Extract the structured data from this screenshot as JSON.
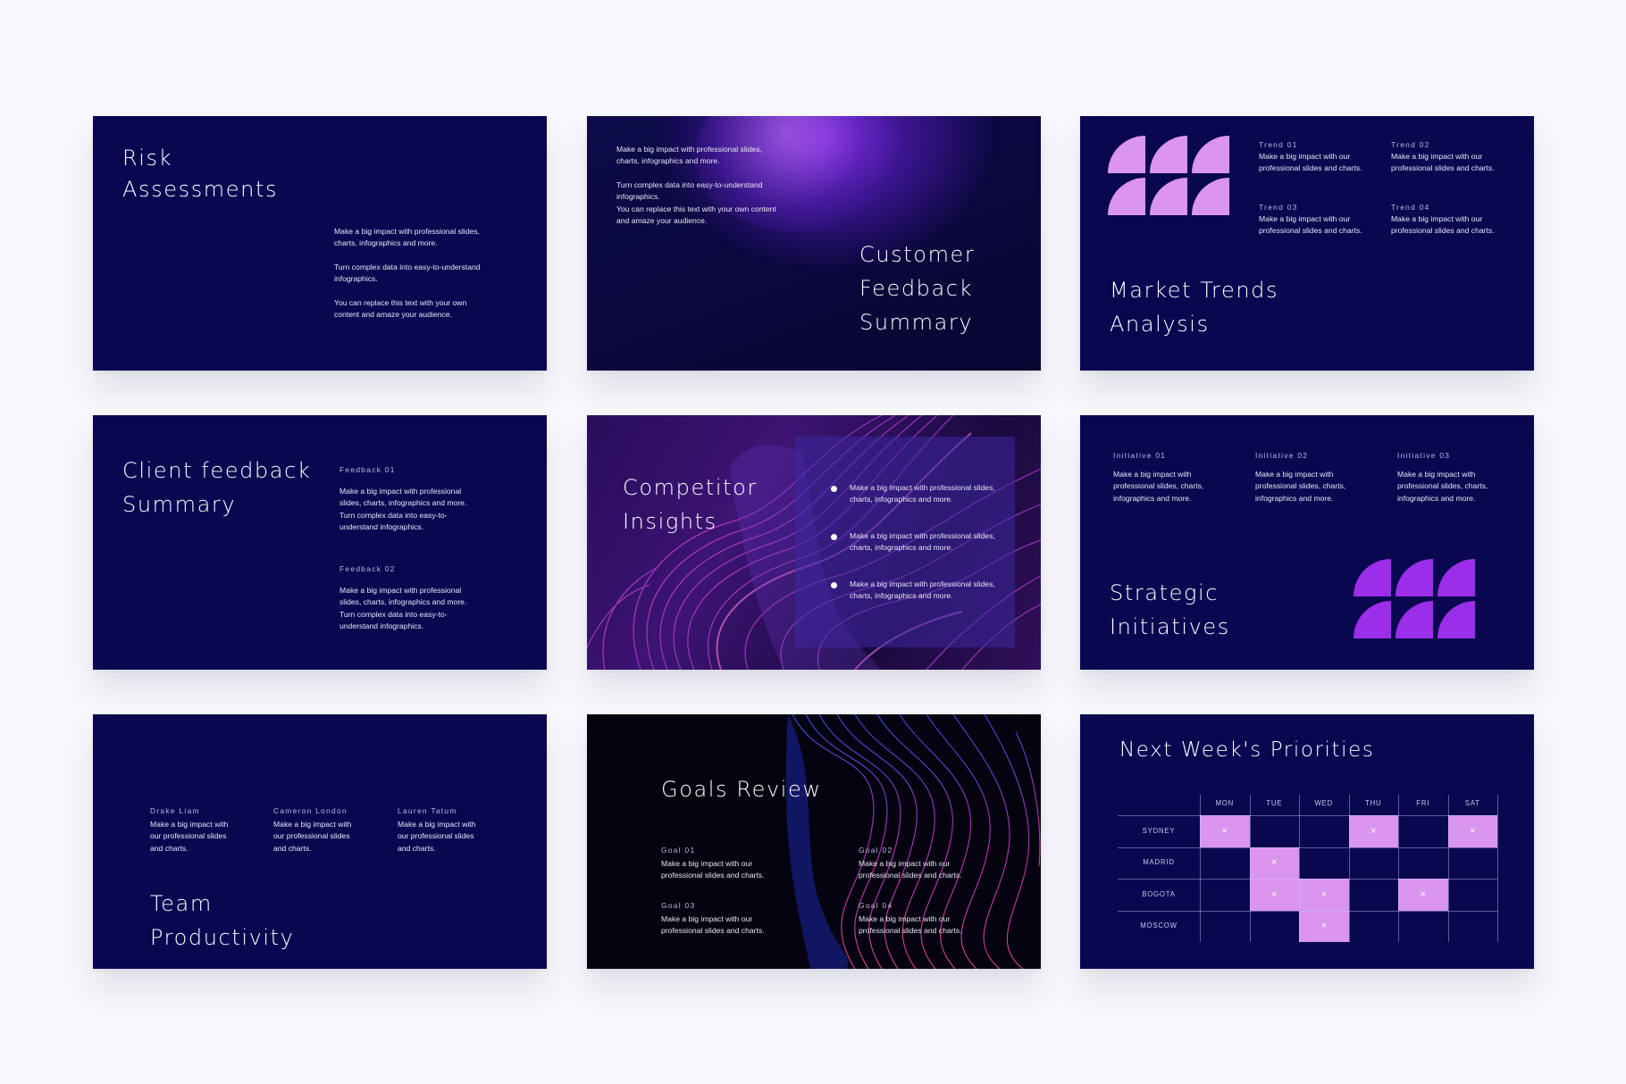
{
  "colors": {
    "page_bg": "#f8f8fc",
    "slide_bg": "#0a0751",
    "accent_pink": "#da95ee",
    "accent_violet": "#9b2ee8",
    "text": "#ffffff"
  },
  "slides": {
    "risk": {
      "title_line1": "Risk",
      "title_line2": "Assessments",
      "body": "Make a big impact with professional slides,\ncharts, infographics and more.\n\nTurn complex data into easy-to-understand\ninfographics.\n\nYou can replace this text with your own\ncontent and amaze your audience."
    },
    "customer": {
      "body": "Make a big impact with professional slides,\ncharts, infographics and more.\n\nTurn complex data into easy-to-understand\ninfographics.\nYou can replace this text with your own content\nand amaze your audience.",
      "title_line1": "Customer",
      "title_line2": "Feedback",
      "title_line3": "Summary"
    },
    "market": {
      "title_line1": "Market Trends",
      "title_line2": "Analysis",
      "trends": [
        {
          "label": "Trend 01",
          "text": "Make a big impact with our\nprofessional slides and charts."
        },
        {
          "label": "Trend 02",
          "text": "Make a big impact with our\nprofessional slides and charts."
        },
        {
          "label": "Trend 03",
          "text": "Make a big impact with our\nprofessional slides and charts."
        },
        {
          "label": "Trend 04",
          "text": "Make a big impact with our\nprofessional slides and charts."
        }
      ]
    },
    "client": {
      "title_line1": "Client feedback",
      "title_line2": "Summary",
      "feedback": [
        {
          "label": "Feedback 01",
          "text": "Make a big impact with professional\nslides, charts, infographics and more.\nTurn complex data into easy-to-\nunderstand infographics."
        },
        {
          "label": "Feedback 02",
          "text": "Make a big impact with professional\nslides, charts, infographics and more.\nTurn complex data into easy-to-\nunderstand infographics."
        }
      ]
    },
    "competitor": {
      "title_line1": "Competitor",
      "title_line2": "Insights",
      "bullets": [
        "Make a big impact with professional slides,\ncharts, infographics and more.",
        "Make a big impact with professional slides,\ncharts, infographics and more.",
        "Make a big impact with professional slides,\ncharts, infographics and more."
      ]
    },
    "strategic": {
      "title_line1": "Strategic",
      "title_line2": "Initiatives",
      "initiatives": [
        {
          "label": "Initiative 01",
          "text": "Make a big impact with\nprofessional slides, charts,\ninfographics and more."
        },
        {
          "label": "Initiative 02",
          "text": "Make a big impact with\nprofessional slides, charts,\ninfographics and more."
        },
        {
          "label": "Initiative 03",
          "text": "Make a big impact with\nprofessional slides, charts,\ninfographics and more."
        }
      ]
    },
    "team": {
      "title_line1": "Team",
      "title_line2": "Productivity",
      "members": [
        {
          "name": "Drake Liam",
          "text": "Make a big impact with\nour professional slides\nand charts."
        },
        {
          "name": "Cameron London",
          "text": "Make a big impact with\nour professional slides\nand charts."
        },
        {
          "name": "Lauren Tatum",
          "text": "Make a big impact with\nour professional slides\nand charts."
        }
      ]
    },
    "goals": {
      "title": "Goals Review",
      "goals": [
        {
          "label": "Goal 01",
          "text": "Make a big impact with our\nprofessional slides and charts."
        },
        {
          "label": "Goal 02",
          "text": "Make a big impact with our\nprofessional slides and charts."
        },
        {
          "label": "Goal 03",
          "text": "Make a big impact with our\nprofessional slides and charts."
        },
        {
          "label": "Goal 04",
          "text": "Make a big impact with our\nprofessional slides and charts."
        }
      ]
    },
    "priorities": {
      "title": "Next Week's Priorities",
      "days": [
        "MON",
        "TUE",
        "WED",
        "THU",
        "FRI",
        "SAT"
      ],
      "cities": [
        "SYDNEY",
        "MADRID",
        "BOGOTA",
        "MOSCOW"
      ],
      "mark": "×",
      "marked": [
        [
          0,
          0
        ],
        [
          0,
          3
        ],
        [
          0,
          5
        ],
        [
          1,
          1
        ],
        [
          2,
          1
        ],
        [
          2,
          2
        ],
        [
          2,
          4
        ],
        [
          3,
          2
        ]
      ]
    }
  }
}
